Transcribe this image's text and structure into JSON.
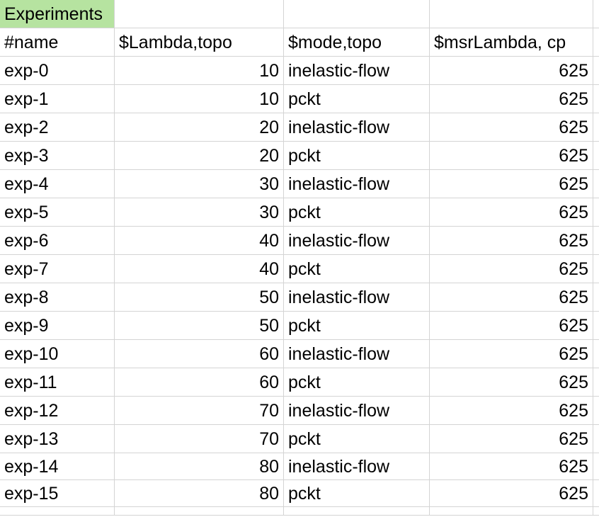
{
  "sheet": {
    "title": "Experiments",
    "headers": [
      "#name",
      "$Lambda,topo",
      "$mode,topo",
      "$msrLambda, cp"
    ],
    "rows": [
      [
        "exp-0",
        "10",
        "inelastic-flow",
        "625"
      ],
      [
        "exp-1",
        "10",
        "pckt",
        "625"
      ],
      [
        "exp-2",
        "20",
        "inelastic-flow",
        "625"
      ],
      [
        "exp-3",
        "20",
        "pckt",
        "625"
      ],
      [
        "exp-4",
        "30",
        "inelastic-flow",
        "625"
      ],
      [
        "exp-5",
        "30",
        "pckt",
        "625"
      ],
      [
        "exp-6",
        "40",
        "inelastic-flow",
        "625"
      ],
      [
        "exp-7",
        "40",
        "pckt",
        "625"
      ],
      [
        "exp-8",
        "50",
        "inelastic-flow",
        "625"
      ],
      [
        "exp-9",
        "50",
        "pckt",
        "625"
      ],
      [
        "exp-10",
        "60",
        "inelastic-flow",
        "625"
      ],
      [
        "exp-11",
        "60",
        "pckt",
        "625"
      ],
      [
        "exp-12",
        "70",
        "inelastic-flow",
        "625"
      ],
      [
        "exp-13",
        "70",
        "pckt",
        "625"
      ],
      [
        "exp-14",
        "80",
        "inelastic-flow",
        "625"
      ],
      [
        "exp-15",
        "80",
        "pckt",
        "625"
      ]
    ],
    "title_fill_color": "#b6e3a0",
    "gridline_color": "#d4d4d4"
  }
}
